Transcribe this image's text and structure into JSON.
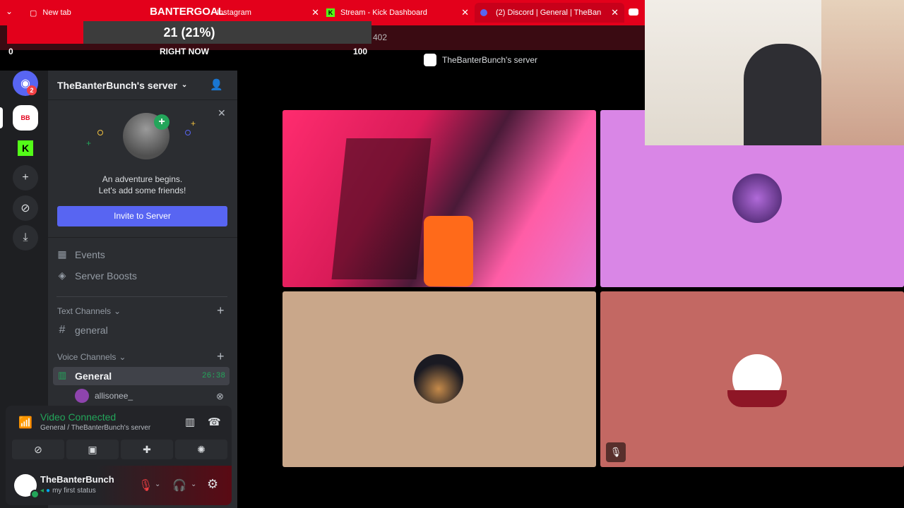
{
  "browser": {
    "tabs": [
      {
        "label": "New tab"
      },
      {
        "label": "Instagram"
      },
      {
        "label": "Stream - Kick Dashboard"
      },
      {
        "label": "(2) Discord | General | TheBan"
      }
    ],
    "address_fragment": "402"
  },
  "goal_overlay": {
    "title": "BANTERGOAL",
    "value": "21 (21%)",
    "progress": 0.21,
    "min": "0",
    "max": "100",
    "label": "RIGHT NOW"
  },
  "discord": {
    "window_title": "TheBanterBunch's server",
    "rail_badge": "2",
    "server_name": "TheBanterBunch's server",
    "invite_card": {
      "line1": "An adventure begins.",
      "line2": "Let's add some friends!",
      "button": "Invite to Server"
    },
    "menu": {
      "events": "Events",
      "boosts": "Server Boosts"
    },
    "text_channels": {
      "category": "Text Channels",
      "items": [
        {
          "label": "general"
        }
      ]
    },
    "voice_channels": {
      "category": "Voice Channels",
      "channel": "General",
      "timer": "26:38",
      "members": [
        {
          "name": "allisonee_"
        }
      ]
    },
    "voice_status": {
      "title": "Video Connected",
      "subtitle": "General / TheBanterBunch's server"
    },
    "user": {
      "name": "TheBanterBunch",
      "status": "my first status"
    }
  },
  "colors": {
    "accent": "#5865f2",
    "brand_red": "#e3001b",
    "connected_green": "#23a55a"
  }
}
